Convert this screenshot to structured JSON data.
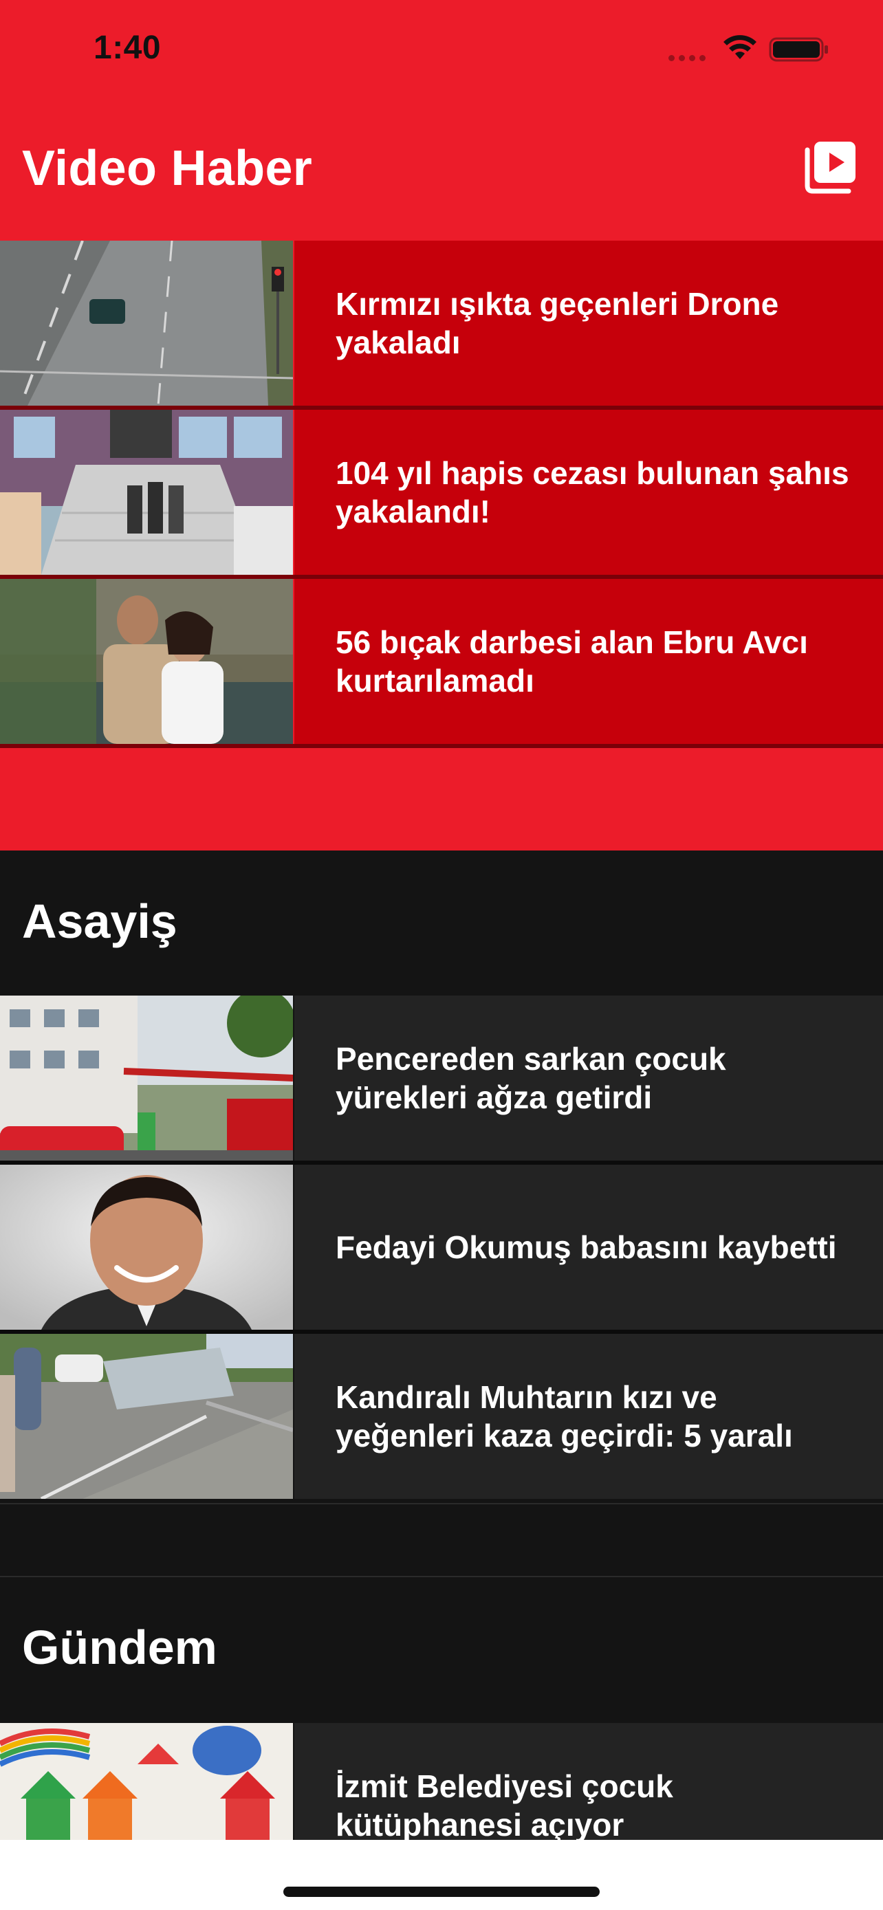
{
  "status_bar": {
    "time": "1:40"
  },
  "header": {
    "title": "Video Haber",
    "video_list_icon": "video-list-icon"
  },
  "featured": [
    {
      "title": "Kırmızı ışıkta geçenleri Drone yakaladı",
      "thumb": "drone-traffic-photo"
    },
    {
      "title": "104 yıl hapis cezası bulunan şahıs yakalandı!",
      "thumb": "arrest-stairs-photo"
    },
    {
      "title": "56 bıçak darbesi alan Ebru Avcı kurtarılamadı",
      "thumb": "couple-photo"
    }
  ],
  "sections": [
    {
      "title": "Asayiş",
      "items": [
        {
          "title": "Pencereden sarkan çocuk yürekleri ağza getirdi",
          "thumb": "fire-truck-building-photo"
        },
        {
          "title": "Fedayi Okumuş babasını kaybetti",
          "thumb": "portrait-man-photo"
        },
        {
          "title": "Kandıralı Muhtarın kızı ve yeğenleri kaza geçirdi: 5 yaralı",
          "thumb": "overturned-car-photo"
        }
      ]
    },
    {
      "title": "Gündem",
      "items": [
        {
          "title": "İzmit Belediyesi çocuk kütüphanesi açıyor",
          "thumb": "children-library-photo"
        }
      ]
    }
  ],
  "colors": {
    "brand_red": "#ec1c2a",
    "row_red": "#c6000b",
    "dark_bg": "#141414",
    "dark_row": "#232323"
  }
}
